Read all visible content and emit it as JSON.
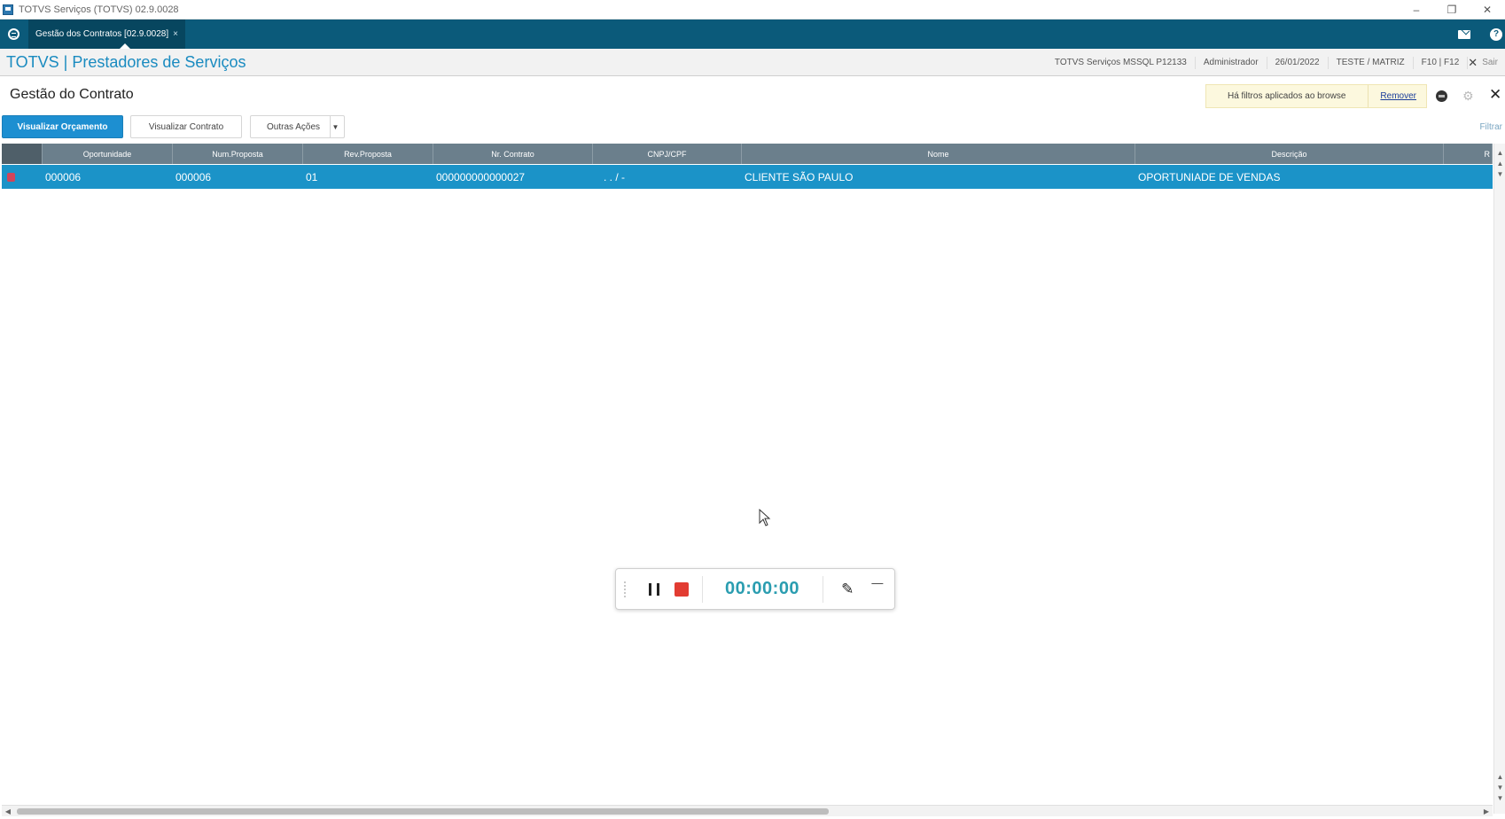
{
  "window": {
    "title": "TOTVS Serviços (TOTVS) 02.9.0028",
    "minimize": "–",
    "restore": "❐",
    "close": "✕"
  },
  "tabs": [
    {
      "label": "Gestão dos Contratos [02.9.0028]",
      "close": "×"
    }
  ],
  "header": {
    "brand": "TOTVS | Prestadores de Serviços",
    "status": [
      "TOTVS Serviços MSSQL P12133",
      "Administrador",
      "26/01/2022",
      "TESTE / MATRIZ",
      "F10 | F12"
    ],
    "logout_icon": "✕",
    "logout_label": "Sair"
  },
  "page": {
    "title": "Gestão do Contrato",
    "filter_banner": "Há filtros aplicados ao browse",
    "remove_label": "Remover",
    "gear": "⚙",
    "close": "✕"
  },
  "toolbar": {
    "primary": "Visualizar Orçamento",
    "secondary": "Visualizar Contrato",
    "dropdown": "Outras Ações",
    "dropdown_arrow": "▼",
    "filter": "Filtrar"
  },
  "grid": {
    "columns": [
      "",
      "Oportunidade",
      "Num.Proposta",
      "Rev.Proposta",
      "Nr. Contrato",
      "CNPJ/CPF",
      "Nome",
      "Descrição",
      "R"
    ],
    "rows": [
      {
        "oportunidade": "000006",
        "num_proposta": "000006",
        "rev_proposta": "01",
        "nr_contrato": "000000000000027",
        "cnpj": ". . / -",
        "nome": "CLIENTE SÃO PAULO",
        "descricao": "OPORTUNIADE DE VENDAS"
      }
    ]
  },
  "scroll": {
    "up": "▲",
    "down": "▼",
    "left": "◀",
    "right": "▶"
  },
  "recorder": {
    "timer": "00:00:00",
    "pen": "✎",
    "minimize": "—"
  },
  "colors": {
    "tabbar": "#0b5a7a",
    "brand": "#1a8bc0",
    "primary_button": "#1d8fd1",
    "selected_row": "#1b93c8",
    "grid_header": "#6b7f8c",
    "stop": "#e23c32",
    "timer": "#2a9db0"
  }
}
